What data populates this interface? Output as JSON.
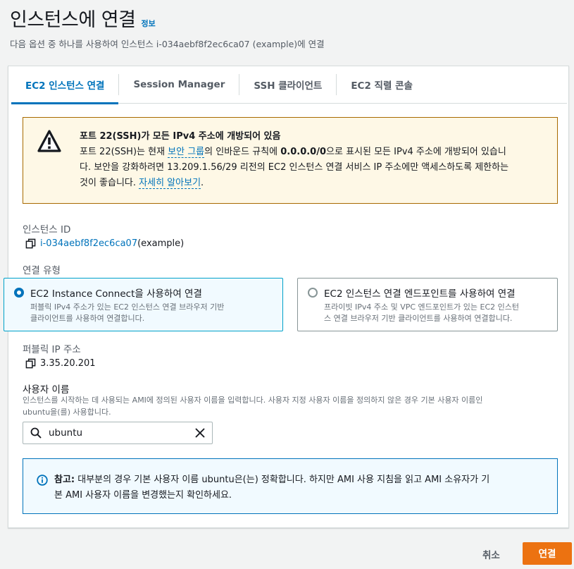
{
  "header": {
    "title": "인스턴스에 연결",
    "info_link": "정보",
    "subtitle": "다음 옵션 중 하나를 사용하여 인스턴스 i-034aebf8f2ec6ca07 (example)에 연결"
  },
  "tabs": [
    {
      "label": "EC2 인스턴스 연결",
      "active": true
    },
    {
      "label": "Session Manager",
      "active": false
    },
    {
      "label": "SSH 클라이언트",
      "active": false
    },
    {
      "label": "EC2 직렬 콘솔",
      "active": false
    }
  ],
  "warning": {
    "title": "포트 22(SSH)가 모든 IPv4 주소에 개방되어 있음",
    "line1_a": "포트 22(SSH)는 현재 ",
    "line1_link": "보안 그룹",
    "line1_b": "의 인바운드 규칙에 ",
    "line1_bold": "0.0.0.0/0",
    "line1_c": "으로 표시된 모든 IPv4 주소에 개방되어 있습니",
    "line2": "다. 보안을 강화하려면 13.209.1.56/29 리전의 EC2 인스턴스 연결 서비스 IP 주소에만 액세스하도록 제한하는",
    "line3_a": "것이 좋습니다. ",
    "line3_link": "자세히 알아보기",
    "line3_b": "."
  },
  "instance_id": {
    "label": "인스턴스 ID",
    "value_link": "i-034aebf8f2ec6ca07",
    "value_suffix": " (example)"
  },
  "connection_type": {
    "label": "연결 유형",
    "options": [
      {
        "title": "EC2 Instance Connect을 사용하여 연결",
        "desc1": "퍼블릭 IPv4 주소가 있는 EC2 인스턴스 연결 브라우저 기반",
        "desc2": "클라이언트를 사용하여 연결합니다.",
        "selected": true
      },
      {
        "title": "EC2 인스턴스 연결 엔드포인트를 사용하여 연결",
        "desc1": "프라이빗 IPv4 주소 및 VPC 엔드포인트가 있는 EC2 인스턴",
        "desc2": "스 연결 브라우저 기반 클라이언트를 사용하여 연결합니다.",
        "selected": false
      }
    ]
  },
  "public_ip": {
    "label": "퍼블릭 IP 주소",
    "value": "3.35.20.201"
  },
  "username": {
    "label": "사용자 이름",
    "desc1": "인스턴스를 시작하는 데 사용되는 AMI에 정의된 사용자 이름을 입력합니다. 사용자 지정 사용자 이름을 정의하지 않은 경우 기본 사용자 이름인",
    "desc2": "ubuntu을(를) 사용합니다.",
    "value": "ubuntu"
  },
  "note": {
    "bold": "참고:",
    "line1": " 대부분의 경우 기본 사용자 이름 ubuntu은(는) 정확합니다. 하지만 AMI 사용 지침을 읽고 AMI 소유자가 기",
    "line2": "본 AMI 사용자 이름을 변경했는지 확인하세요."
  },
  "footer": {
    "cancel_label": "취소",
    "connect_label": "연결"
  },
  "colors": {
    "accent": "#0073bb",
    "primary_button": "#ec7211",
    "warning_border": "#a86a00",
    "warning_bg": "#fef8e6"
  }
}
